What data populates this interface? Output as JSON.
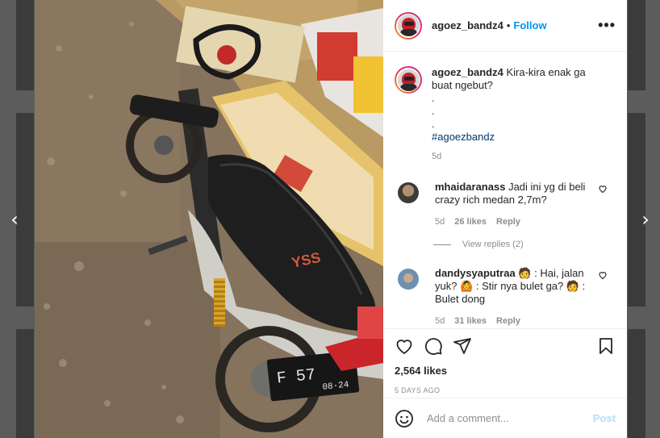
{
  "header": {
    "username": "agoez_bandz4",
    "separator": "•",
    "follow_label": "Follow",
    "more_icon": "more-horizontal-icon"
  },
  "caption": {
    "username": "agoez_bandz4",
    "text": "Kira-kira enak ga buat ngebut?",
    "dots": [
      ".",
      ".",
      "."
    ],
    "hashtag": "#agoezbandz",
    "age": "5d"
  },
  "comments": [
    {
      "username": "mhaidaranass",
      "text": "Jadi ini yg di beli crazy rich medan 2,7m?",
      "age": "5d",
      "likes": "26 likes",
      "reply_label": "Reply",
      "view_replies": "View replies (2)"
    },
    {
      "username": "dandysyaputraa",
      "text": "🧑 : Hai, jalan yuk? 🙆 : Stir nya bulet ga? 🧑 : Bulet dong",
      "age": "5d",
      "likes": "31 likes",
      "reply_label": "Reply"
    }
  ],
  "actions": {
    "likes": "2,564 likes",
    "time": "5 DAYS AGO",
    "icons": [
      "heart-icon",
      "comment-icon",
      "share-icon",
      "bookmark-icon"
    ]
  },
  "add_comment": {
    "placeholder": "Add a comment...",
    "post_label": "Post",
    "emoji_icon": "smiley-icon"
  },
  "colors": {
    "accent": "#0095f6",
    "post_disabled": "#b2dffc",
    "text": "#262626",
    "muted": "#8e8e8e"
  }
}
